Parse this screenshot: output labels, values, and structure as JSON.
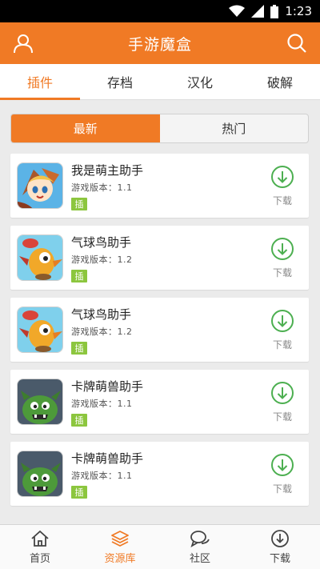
{
  "status_bar": {
    "time": "1:23"
  },
  "header": {
    "title": "手游魔盒"
  },
  "tabs": [
    {
      "label": "插件",
      "active": true
    },
    {
      "label": "存档",
      "active": false
    },
    {
      "label": "汉化",
      "active": false
    },
    {
      "label": "破解",
      "active": false
    }
  ],
  "segment": {
    "latest": "最新",
    "hot": "热门"
  },
  "apps": [
    {
      "name": "我是萌主助手",
      "version": "游戏版本：1.1",
      "badge": "插",
      "download": "下载",
      "icon": "hero-girl-icon"
    },
    {
      "name": "气球鸟助手",
      "version": "游戏版本：1.2",
      "badge": "插",
      "download": "下载",
      "icon": "balloon-bird-icon"
    },
    {
      "name": "气球鸟助手",
      "version": "游戏版本：1.2",
      "badge": "插",
      "download": "下载",
      "icon": "balloon-bird-icon"
    },
    {
      "name": "卡牌萌兽助手",
      "version": "游戏版本：1.1",
      "badge": "插",
      "download": "下载",
      "icon": "green-monster-icon"
    },
    {
      "name": "卡牌萌兽助手",
      "version": "游戏版本：1.1",
      "badge": "插",
      "download": "下载",
      "icon": "green-monster-icon"
    }
  ],
  "bottom_nav": [
    {
      "label": "首页",
      "icon": "home-icon",
      "active": false
    },
    {
      "label": "资源库",
      "icon": "layers-icon",
      "active": true
    },
    {
      "label": "社区",
      "icon": "chat-icon",
      "active": false
    },
    {
      "label": "下载",
      "icon": "download-circle-icon",
      "active": false
    }
  ],
  "colors": {
    "accent": "#f07a25",
    "badge": "#8cc63e",
    "download_green": "#4caf50"
  }
}
